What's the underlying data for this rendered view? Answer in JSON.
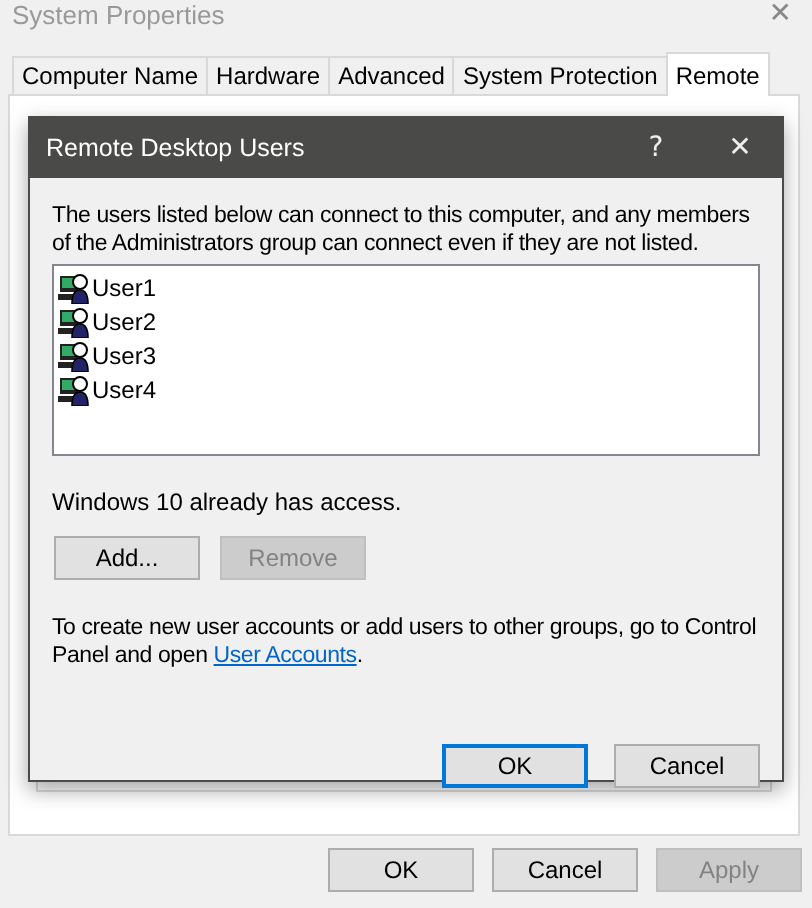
{
  "window": {
    "title": "System Properties",
    "close": "✕"
  },
  "tabs": [
    {
      "label": "Computer Name",
      "selected": false
    },
    {
      "label": "Hardware",
      "selected": false
    },
    {
      "label": "Advanced",
      "selected": false
    },
    {
      "label": "System Protection",
      "selected": false
    },
    {
      "label": "Remote",
      "selected": true
    }
  ],
  "dialog": {
    "title": "Remote Desktop Users",
    "help": "?",
    "close": "✕",
    "description": "The users listed below can connect to this computer, and any members of the Administrators group can connect even if they are not listed.",
    "users": [
      "User1",
      "User2",
      "User3",
      "User4"
    ],
    "access_note": "Windows 10 already has access.",
    "list_buttons": [
      {
        "label": "Add...",
        "disabled": false
      },
      {
        "label": "Remove",
        "disabled": true
      }
    ],
    "footer": {
      "before": "To create new user accounts or add users to other groups, go to Control Panel and open ",
      "link": "User Accounts",
      "after": "."
    },
    "buttons": [
      {
        "label": "OK",
        "default": true
      },
      {
        "label": "Cancel",
        "default": false
      }
    ]
  },
  "buttons": [
    {
      "label": "OK",
      "disabled": false
    },
    {
      "label": "Cancel",
      "disabled": false
    },
    {
      "label": "Apply",
      "disabled": true
    }
  ]
}
